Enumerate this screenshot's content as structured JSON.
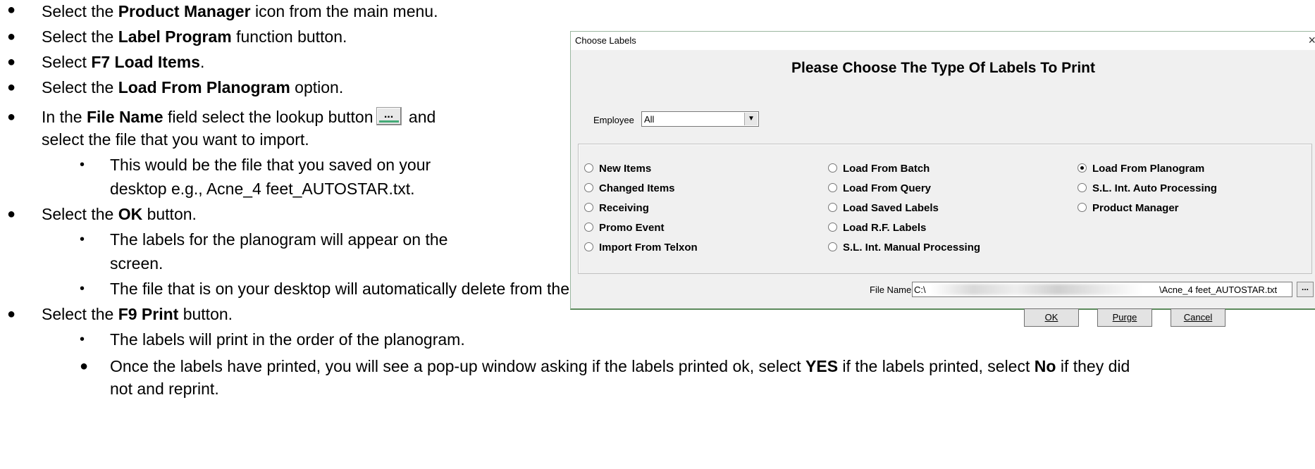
{
  "steps": [
    {
      "pre": "Select the ",
      "bold": "Product Manager",
      "post": " icon from the main menu."
    },
    {
      "pre": "Select the ",
      "bold": "Label Program",
      "post": " function button."
    },
    {
      "pre": "Select ",
      "bold": "F7 Load Items",
      "post": "."
    },
    {
      "pre": "Select the ",
      "bold": "Load From Planogram",
      "post": " option."
    },
    {
      "pre": "In the ",
      "bold": "File Name",
      "mid": " field select the lookup button",
      "post": " and",
      "cont": "select the file that you want to import."
    },
    {
      "sub1": "This would be the file that you saved on your",
      "sub2": "desktop e.g., Acne_4 feet_AUTOSTAR.txt."
    },
    {
      "pre": "Select the ",
      "bold": "OK",
      "post": " button."
    },
    {
      "sub1": "The labels for the planogram will appear on the",
      "sub2": "screen."
    },
    {
      "sub1": "The file that is on your desktop will automatically delete from the desktop."
    },
    {
      "pre": "Select the ",
      "bold": "F9 Print",
      "post": " button."
    },
    {
      "sub1": "The labels will print in the order of the planogram."
    },
    {
      "a": "Once the labels have printed, you will see a pop-up window asking if the labels printed ok, select ",
      "b1": "YES",
      "c": " if the labels printed, select ",
      "b2": "No",
      "d": " if they did",
      "e": "not and reprint."
    }
  ],
  "lookup_glyph": "...",
  "dialog": {
    "title": "Choose Labels",
    "close": "×",
    "headline": "Please Choose The Type Of Labels To Print",
    "employee_label": "Employee",
    "employee_value": "All",
    "options": {
      "new_items": "New Items",
      "changed_items": "Changed Items",
      "receiving": "Receiving",
      "promo_event": "Promo Event",
      "import_telxon": "Import From Telxon",
      "load_batch": "Load From Batch",
      "load_query": "Load From Query",
      "load_saved": "Load Saved Labels",
      "load_rf": "Load R.F. Labels",
      "sl_manual": "S.L. Int. Manual Processing",
      "load_planogram": "Load From Planogram",
      "sl_auto": "S.L. Int. Auto Processing",
      "product_manager": "Product Manager"
    },
    "selected_option": "Load From Planogram",
    "file_name_label": "File Name",
    "file_prefix": "C:\\",
    "file_suffix": "\\Acne_4 feet_AUTOSTAR.txt",
    "buttons": {
      "ok": "OK",
      "purge": "Purge",
      "cancel": "Cancel"
    }
  }
}
